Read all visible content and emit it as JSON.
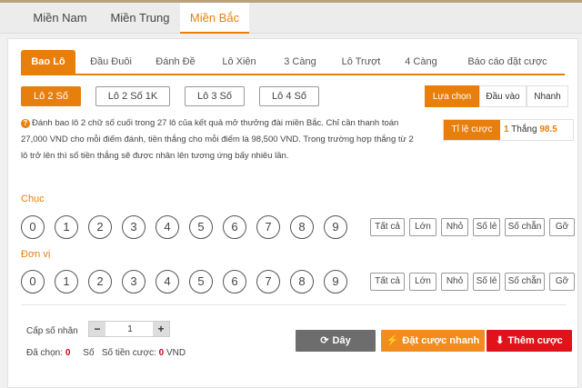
{
  "region_tabs": [
    {
      "label": "Miền Nam"
    },
    {
      "label": "Miền Trung"
    },
    {
      "label": "Miền Bắc"
    }
  ],
  "game_tabs": [
    {
      "label": "Bao Lô"
    },
    {
      "label": "Đầu Đuôi"
    },
    {
      "label": "Đánh Đề"
    },
    {
      "label": "Lô Xiên"
    },
    {
      "label": "3 Càng"
    },
    {
      "label": "Lô Trượt"
    },
    {
      "label": "4 Càng"
    },
    {
      "label": "Báo cáo đặt cược"
    }
  ],
  "sub_tabs": [
    {
      "label": "Lô 2 Số"
    },
    {
      "label": "Lô 2 Số 1K"
    },
    {
      "label": "Lô 3 Số"
    },
    {
      "label": "Lô 4 Số"
    }
  ],
  "modes": [
    {
      "label": "Lựa chọn"
    },
    {
      "label": "Đầu vào"
    },
    {
      "label": "Nhanh"
    }
  ],
  "description": {
    "line1": "Đánh bao lô 2 chữ số cuối trong 27 lô của kết quả mở thưởng đài miền Bắc. Chỉ cần thanh toán",
    "line2": "27,000 VND cho mỗi điểm đánh, tiền thắng cho mỗi điểm là 98,500 VND. Trong trường hợp thắng từ 2",
    "line3": "lô trở lên thì số tiền thắng sẽ được nhân lên tương ứng bấy nhiêu lần."
  },
  "rate": {
    "label": "Tỉ lệ cược",
    "prefix_num": "1",
    "prefix_text": "Thắng",
    "value": "98.5"
  },
  "rows": {
    "tens": {
      "label": "Chục"
    },
    "units": {
      "label": "Đơn vị"
    }
  },
  "numbers": [
    "0",
    "1",
    "2",
    "3",
    "4",
    "5",
    "6",
    "7",
    "8",
    "9"
  ],
  "quick": [
    "Tất cả",
    "Lớn",
    "Nhỏ",
    "Số lẻ",
    "Số chẵn",
    "Gỡ"
  ],
  "multiplier": {
    "label": "Cấp số nhân",
    "value": "1",
    "minus": "−",
    "plus": "+"
  },
  "summary": {
    "selected_label": "Đã chọn:",
    "selected_value": "0",
    "unit": "Số",
    "amount_label": "Số tiền cược:",
    "amount_value": "0",
    "currency": "VND"
  },
  "actions": {
    "clear": "Dây",
    "quick_bet": "Đặt cược nhanh",
    "add_bet": "Thêm cược"
  },
  "colors": {
    "accent": "#e87f0d",
    "danger": "#e0121b",
    "neutral": "#6d6d6d"
  }
}
